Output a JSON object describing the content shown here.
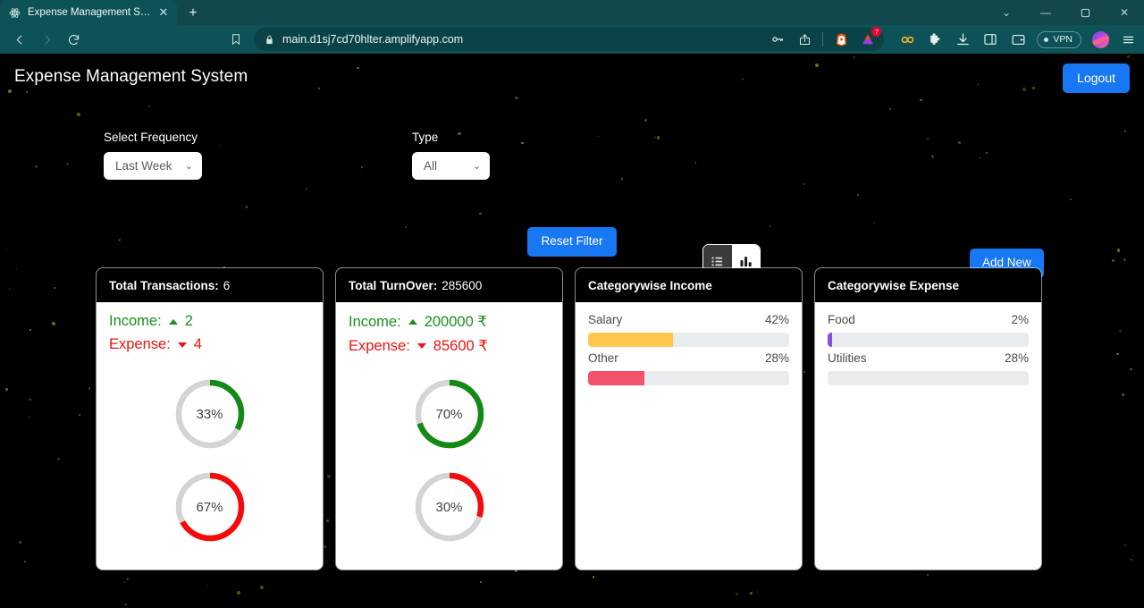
{
  "browser": {
    "tab": {
      "title": "Expense Management System",
      "favicon_icon": "atom-icon",
      "close_icon": "close-icon"
    },
    "new_tab_icon": "plus-icon",
    "window_controls": [
      {
        "name": "tab-search",
        "icon": "chevron-down-icon",
        "glyph": "∨"
      },
      {
        "name": "minimize",
        "icon": "minimize-icon",
        "glyph": "—"
      },
      {
        "name": "maximize",
        "icon": "maximize-icon",
        "glyph": "⬜"
      },
      {
        "name": "close-window",
        "icon": "close-icon",
        "glyph": "✕"
      }
    ],
    "nav": {
      "back_icon": "back-arrow-icon",
      "forward_icon": "forward-arrow-icon",
      "reload_icon": "reload-icon",
      "bookmark_icon": "bookmark-icon"
    },
    "url": "main.d1sj7cd70hlter.amplifyapp.com",
    "lock_icon": "lock-icon",
    "url_actions": [
      {
        "name": "password-manager",
        "icon": "key-icon"
      },
      {
        "name": "share-page",
        "icon": "share-icon"
      },
      {
        "name": "brave-shields",
        "icon": "brave-lion-icon"
      },
      {
        "name": "brave-rewards",
        "icon": "brave-triangle-icon",
        "badge": "7"
      }
    ],
    "toolbar": [
      {
        "name": "leo-ai",
        "icon": "infinity-icon"
      },
      {
        "name": "extensions",
        "icon": "puzzle-icon"
      },
      {
        "name": "downloads",
        "icon": "download-icon"
      },
      {
        "name": "sidebar-toggle",
        "icon": "panel-icon"
      },
      {
        "name": "wallet",
        "icon": "wallet-icon"
      },
      {
        "name": "vpn",
        "icon": "vpn-icon",
        "label": "VPN"
      },
      {
        "name": "profile",
        "icon": "avatar-icon"
      },
      {
        "name": "main-menu",
        "icon": "hamburger-menu-icon"
      }
    ]
  },
  "app": {
    "title": "Expense Management System",
    "logout_label": "Logout",
    "filters": {
      "frequency": {
        "label": "Select Frequency",
        "value": "Last Week",
        "chevron_icon": "chevron-down-icon"
      },
      "type": {
        "label": "Type",
        "value": "All",
        "chevron_icon": "chevron-down-icon"
      }
    },
    "view_toggle": {
      "list_icon": "list-view-icon",
      "chart_icon": "bar-chart-view-icon",
      "active": "chart"
    },
    "add_new_label": "Add New",
    "reset_filter_label": "Reset Filter",
    "cards": [
      {
        "name": "total-transactions",
        "head_label": "Total Transactions:",
        "head_value": "6",
        "income_label": "Income:",
        "income_value": "2",
        "expense_label": "Expense:",
        "expense_value": "4",
        "donuts": [
          {
            "name": "income-percent",
            "label": "33%",
            "percent": 33,
            "color": "#138a13"
          },
          {
            "name": "expense-percent",
            "label": "67%",
            "percent": 67,
            "color": "#f40c0c"
          }
        ]
      },
      {
        "name": "total-turnover",
        "head_label": "Total TurnOver:",
        "head_value": "285600",
        "income_label": "Income:",
        "income_value": "200000 ₹",
        "expense_label": "Expense:",
        "expense_value": "85600 ₹",
        "donuts": [
          {
            "name": "income-percent",
            "label": "70%",
            "percent": 70,
            "color": "#138a13"
          },
          {
            "name": "expense-percent",
            "label": "30%",
            "percent": 30,
            "color": "#f40c0c"
          }
        ]
      }
    ],
    "categorywise_income": {
      "title": "Categorywise Income",
      "rows": [
        {
          "label": "Salary",
          "percent_label": "42%",
          "percent": 42,
          "color": "#ffc84d"
        },
        {
          "label": "Other",
          "percent_label": "28%",
          "percent": 28,
          "color": "#f2536a"
        }
      ]
    },
    "categorywise_expense": {
      "title": "Categorywise Expense",
      "rows": [
        {
          "label": "Food",
          "percent_label": "2%",
          "percent": 2,
          "color": "#8b4ddb"
        },
        {
          "label": "Utilities",
          "percent_label": "28%",
          "percent": 28,
          "color": "#7ac援"
        }
      ]
    }
  },
  "chart_data": [
    {
      "type": "pie",
      "title": "Total Transactions: 6",
      "categories": [
        "Income",
        "Expense"
      ],
      "values": [
        33,
        67
      ],
      "raw_counts": [
        2,
        4
      ],
      "unit": "%",
      "colors": [
        "#138a13",
        "#f40c0c"
      ]
    },
    {
      "type": "pie",
      "title": "Total TurnOver: 285600",
      "categories": [
        "Income",
        "Expense"
      ],
      "values": [
        70,
        30
      ],
      "raw_amounts": [
        200000,
        85600
      ],
      "unit": "%",
      "colors": [
        "#138a13",
        "#f40c0c"
      ]
    },
    {
      "type": "bar",
      "title": "Categorywise Income",
      "categories": [
        "Salary",
        "Other"
      ],
      "values": [
        42,
        28
      ],
      "ylim": [
        0,
        100
      ],
      "unit": "%",
      "colors": [
        "#ffc84d",
        "#f2536a"
      ]
    },
    {
      "type": "bar",
      "title": "Categorywise Expense",
      "categories": [
        "Food",
        "Utilities"
      ],
      "values": [
        2,
        28
      ],
      "ylim": [
        0,
        100
      ],
      "unit": "%",
      "colors": [
        "#8b4ddb",
        "#7ac943"
      ]
    }
  ]
}
